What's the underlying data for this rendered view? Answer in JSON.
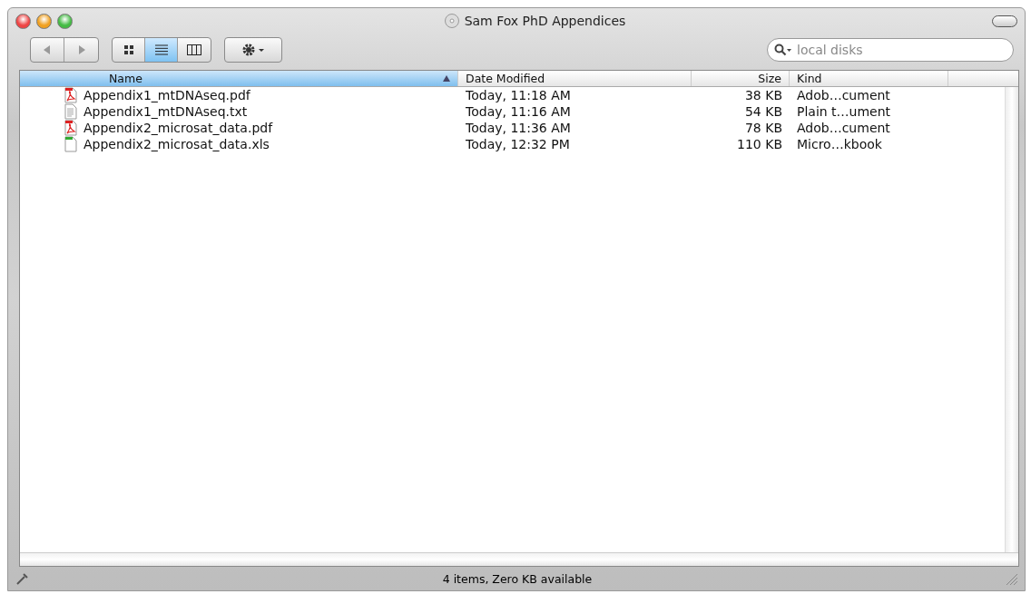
{
  "window": {
    "title": "Sam Fox PhD Appendices"
  },
  "view_buttons": [
    {
      "kind": "icons",
      "selected": false
    },
    {
      "kind": "list",
      "selected": true
    },
    {
      "kind": "columns",
      "selected": false
    }
  ],
  "search": {
    "placeholder": "local disks"
  },
  "table": {
    "columns": [
      {
        "label": "Name",
        "selected": true
      },
      {
        "label": "Date Modified",
        "selected": false
      },
      {
        "label": "Size",
        "selected": false
      },
      {
        "label": "Kind",
        "selected": false
      }
    ],
    "rows": [
      {
        "kind": "pdf",
        "name": "Appendix1_mtDNAseq.pdf",
        "date": "Today, 11:18 AM",
        "size": "38 KB",
        "type": "Adob…cument"
      },
      {
        "kind": "text",
        "name": "Appendix1_mtDNAseq.txt",
        "date": "Today, 11:16 AM",
        "size": "54 KB",
        "type": "Plain t…ument"
      },
      {
        "kind": "pdf",
        "name": "Appendix2_microsat_data.pdf",
        "date": "Today, 11:36 AM",
        "size": "78 KB",
        "type": "Adob…cument"
      },
      {
        "kind": "sheet",
        "name": "Appendix2_microsat_data.xls",
        "date": "Today, 12:32 PM",
        "size": "110 KB",
        "type": "Micro…kbook"
      }
    ]
  },
  "status_bar": "4 items, Zero KB available"
}
